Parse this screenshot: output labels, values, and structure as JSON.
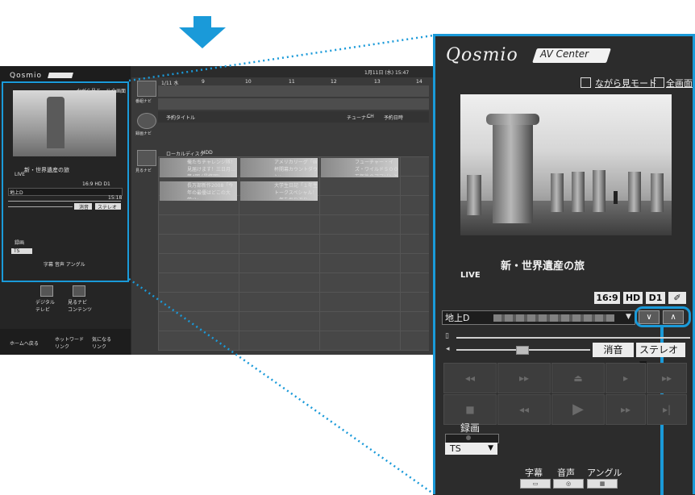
{
  "colors": {
    "accent": "#1a9ad9",
    "panel_bg": "#2c2c2c"
  },
  "large": {
    "logo": "Qosmio",
    "logo_badge": "AV Center",
    "mode_link": "ながら見モード",
    "fullscreen_link": "全画面",
    "program_title": "新・世界遺産の旅",
    "live": "LIVE",
    "badges": [
      "16:9",
      "HD",
      "D1",
      "✐"
    ],
    "channel_label": "地上D",
    "down_label": "∨",
    "up_label": "∧",
    "mute_label": "消音",
    "stereo_label": "ステレオ",
    "rec_label": "録画",
    "rec_format": "TS",
    "options": [
      {
        "label": "字幕",
        "icon": "subtitle-icon"
      },
      {
        "label": "音声",
        "icon": "audio-icon"
      },
      {
        "label": "アングル",
        "icon": "angle-icon"
      }
    ]
  },
  "thumb": {
    "logo": "Qosmio",
    "logo_badge": "AV Center",
    "mode_link": "ながら見モード",
    "fullscreen_link": "全画面",
    "program_title": "新・世界遺産の旅",
    "live": "LIVE",
    "badges": "16:9 HD D1",
    "channel_label": "地上D",
    "mute_label": "消音",
    "stereo_label": "ステレオ",
    "time_label": "15:18",
    "rec_label": "録画",
    "rec_format": "TS",
    "options": "字幕  音声  アングル",
    "bottom_icons": [
      "デジタル\nテレビ",
      "見るナビ\nコンテンツ"
    ],
    "footer": [
      "ホームへ戻る",
      "ホットワード\nリンク",
      "気になる\nリンク"
    ],
    "date_time": "1月11日 (水) 15:47",
    "timeline_start": "1/11 水",
    "hours": [
      "9",
      "10",
      "11",
      "12",
      "13",
      "14"
    ],
    "navs": [
      "番組ナビ",
      "録画ナビ",
      "見るナビ"
    ],
    "reserve_headers": [
      "予約タイトル",
      "チューナー",
      "CH",
      "予約日時"
    ],
    "local_disk": "ローカルディスク",
    "hdd": "HDD",
    "recordings": [
      {
        "title": "俺たちチャレンジ隊！見届けます！三日月…第4回 (最終回)",
        "date": "12/16",
        "time": ""
      },
      {
        "title": "アメリカリーグ「W杯開幕カウントダウン」",
        "date": "12/18",
        "time": "(03:15:10)"
      },
      {
        "title": "フューチャー・イズ・ワイルド５００万年後のアマゾンと太",
        "date": "12/15",
        "time": "(03:15:00)"
      },
      {
        "title": "長万部新作2008「今年の最優はどこの大学!?」",
        "date": "12/30",
        "time": "(02:30:10)"
      },
      {
        "title": "大学生日記「１年生トークスペシャル！一年を振り返り」",
        "date": "12/31",
        "time": "(00:54:50)"
      }
    ]
  }
}
